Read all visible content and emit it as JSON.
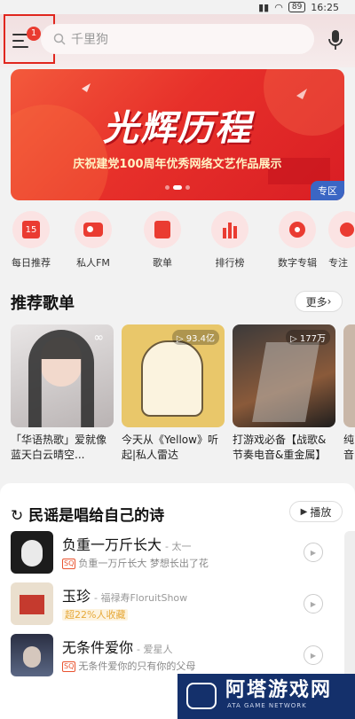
{
  "status_bar": {
    "time": "16:25",
    "battery": "89"
  },
  "header": {
    "menu_badge": "1",
    "search_placeholder": "千里狗"
  },
  "banner": {
    "title": "光辉历程",
    "subtitle": "庆祝建党100周年优秀网络文艺作品展示",
    "tag": "专区"
  },
  "quick_nav": [
    {
      "label": "每日推荐",
      "icon": "calendar-icon",
      "badge": "15"
    },
    {
      "label": "私人FM",
      "icon": "radio-icon"
    },
    {
      "label": "歌单",
      "icon": "playlist-icon"
    },
    {
      "label": "排行榜",
      "icon": "chart-icon"
    },
    {
      "label": "数字专辑",
      "icon": "album-icon"
    },
    {
      "label": "专注",
      "icon": "focus-icon"
    }
  ],
  "recommend": {
    "title": "推荐歌单",
    "more_label": "更多",
    "playlists": [
      {
        "title": "「华语热歌」爱就像蓝天白云晴空...",
        "count": ""
      },
      {
        "title": "今天从《Yellow》听起|私人雷达",
        "count": "93.4亿"
      },
      {
        "title": "打游戏必备【战歌&节奏电音&重金属】",
        "count": "177万"
      },
      {
        "title": "纯音乐 摇滚",
        "count": ""
      }
    ]
  },
  "song_section": {
    "title": "民谣是唱给自己的诗",
    "play_label": "播放",
    "songs": [
      {
        "name": "负重一万斤长大",
        "artist": "- 太一",
        "sub": "负重一万斤长大 梦想长出了花",
        "sq": true
      },
      {
        "name": "玉珍",
        "artist": "- 福禄寿FloruitShow",
        "sub": "超22%人收藏",
        "sq": false
      },
      {
        "name": "无条件爱你",
        "artist": "- 爱星人",
        "sub": "无条件爱你的只有你的父母",
        "sq": true
      }
    ]
  },
  "watermark": {
    "main": "阿塔游戏网",
    "sub": "ATA GAME NETWORK"
  },
  "colors": {
    "accent": "#e93b30",
    "banner": "#e7302a"
  }
}
